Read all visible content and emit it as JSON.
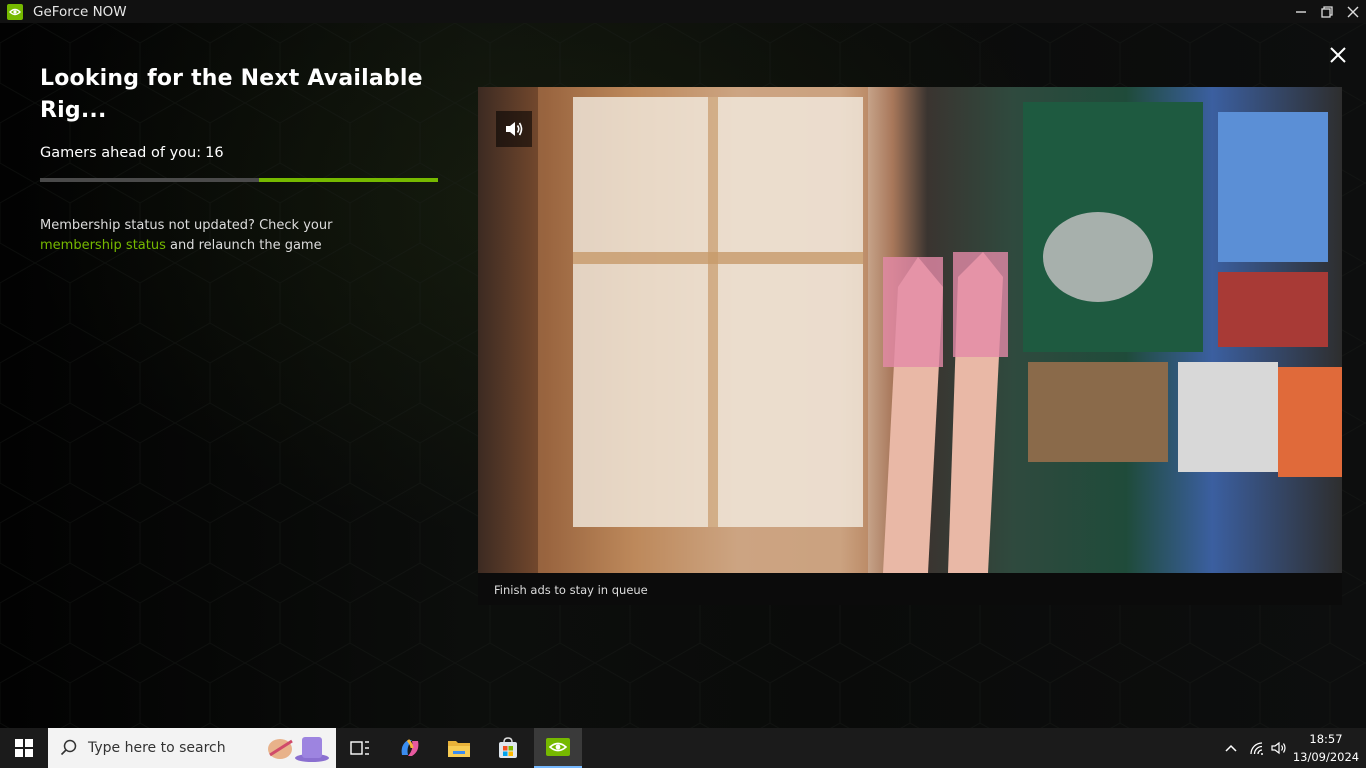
{
  "window": {
    "title": "GeForce NOW"
  },
  "queue": {
    "heading": "Looking for the Next Available Rig...",
    "gamers_ahead_label": "Gamers ahead of you:",
    "gamers_ahead_count": "16",
    "progress": 0.45,
    "membership_text_1": "Membership status not updated? Check your",
    "membership_link": "membership status",
    "membership_text_2": "and relaunch the game"
  },
  "ad": {
    "caption": "Finish ads to stay in queue"
  },
  "taskbar": {
    "search_placeholder": "Type here to search",
    "time": "18:57",
    "date": "13/09/2024"
  },
  "colors": {
    "accent": "#76b900",
    "background": "#000000",
    "taskbar": "#1b1b1b"
  }
}
